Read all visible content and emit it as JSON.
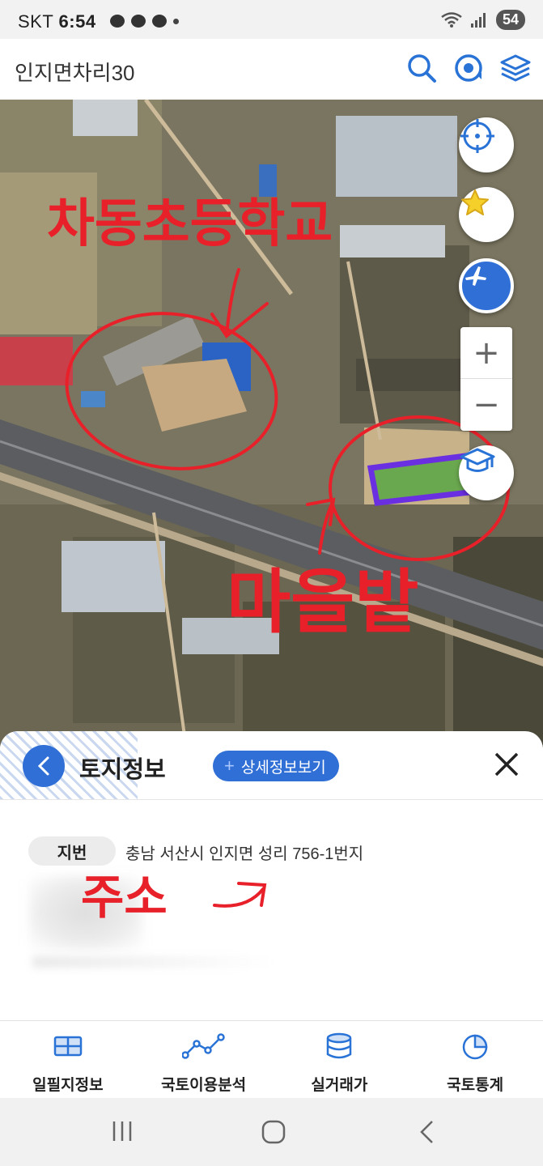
{
  "status_bar": {
    "carrier": "SKT",
    "time": "6:54",
    "battery": "54"
  },
  "app_bar": {
    "title": "인지면차리30",
    "icons": [
      "search-icon",
      "location-refresh-icon",
      "layers-icon"
    ]
  },
  "map": {
    "controls": {
      "locate_icon": "crosshair-icon",
      "favorite_icon": "star-icon",
      "flight_icon": "airplane-icon",
      "zoom_in": "+",
      "zoom_out": "−",
      "school_icon": "graduation-cap-icon"
    },
    "annotations": {
      "school": "차동초등학교",
      "village_field": "마을밭",
      "address_note": "주소"
    },
    "colors": {
      "parcel_outline": "#6a2fe0",
      "parcel_fill": "#6aa84f",
      "annotation": "#e8202a"
    }
  },
  "sheet": {
    "title": "토지정보",
    "detail_button": "상세정보보기",
    "parcel_label": "지번",
    "parcel_address": "충남 서산시 인지면 성리 756-1번지",
    "accent": "#2f6fd6"
  },
  "bottom_nav": {
    "items": [
      {
        "label": "일필지정보",
        "icon": "map-grid-icon"
      },
      {
        "label": "국토이용분석",
        "icon": "trend-line-icon"
      },
      {
        "label": "실거래가",
        "icon": "database-icon"
      },
      {
        "label": "국토통계",
        "icon": "pie-chart-icon"
      }
    ]
  },
  "system_nav": [
    "recent-apps-icon",
    "home-icon",
    "back-icon"
  ]
}
